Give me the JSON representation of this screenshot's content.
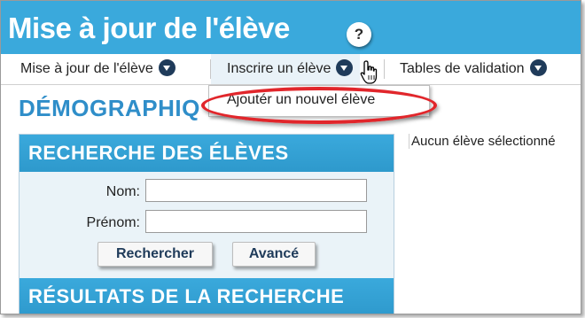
{
  "window": {
    "title": "Mise à jour de l'élève",
    "help_glyph": "?"
  },
  "tabs": [
    {
      "label": "Mise à jour de l'élève",
      "icon": "chevron-down-icon"
    },
    {
      "label": "Inscrire un élève",
      "icon": "chevron-down-icon"
    },
    {
      "label": "Tables de validation",
      "icon": "chevron-down-icon"
    }
  ],
  "dropdown": {
    "items": [
      {
        "label": "Ajoutér un nouvel élève"
      }
    ]
  },
  "main": {
    "section_title": "DÉMOGRAPHIQ",
    "empty_message": "Aucun élève sélectionné"
  },
  "search": {
    "header": "RECHERCHE DES ÉLÈVES",
    "last_name_label": "Nom:",
    "last_name_value": "",
    "first_name_label": "Prénom:",
    "first_name_value": "",
    "search_button": "Rechercher",
    "advanced_button": "Avancé"
  },
  "results": {
    "header": "RÉSULTATS DE LA RECHERCHE"
  },
  "colors": {
    "header_blue": "#3aa9dc",
    "heading_blue": "#2f8ec9",
    "highlight_red": "#e1262b",
    "chevron_navy": "#1f3b5a"
  }
}
